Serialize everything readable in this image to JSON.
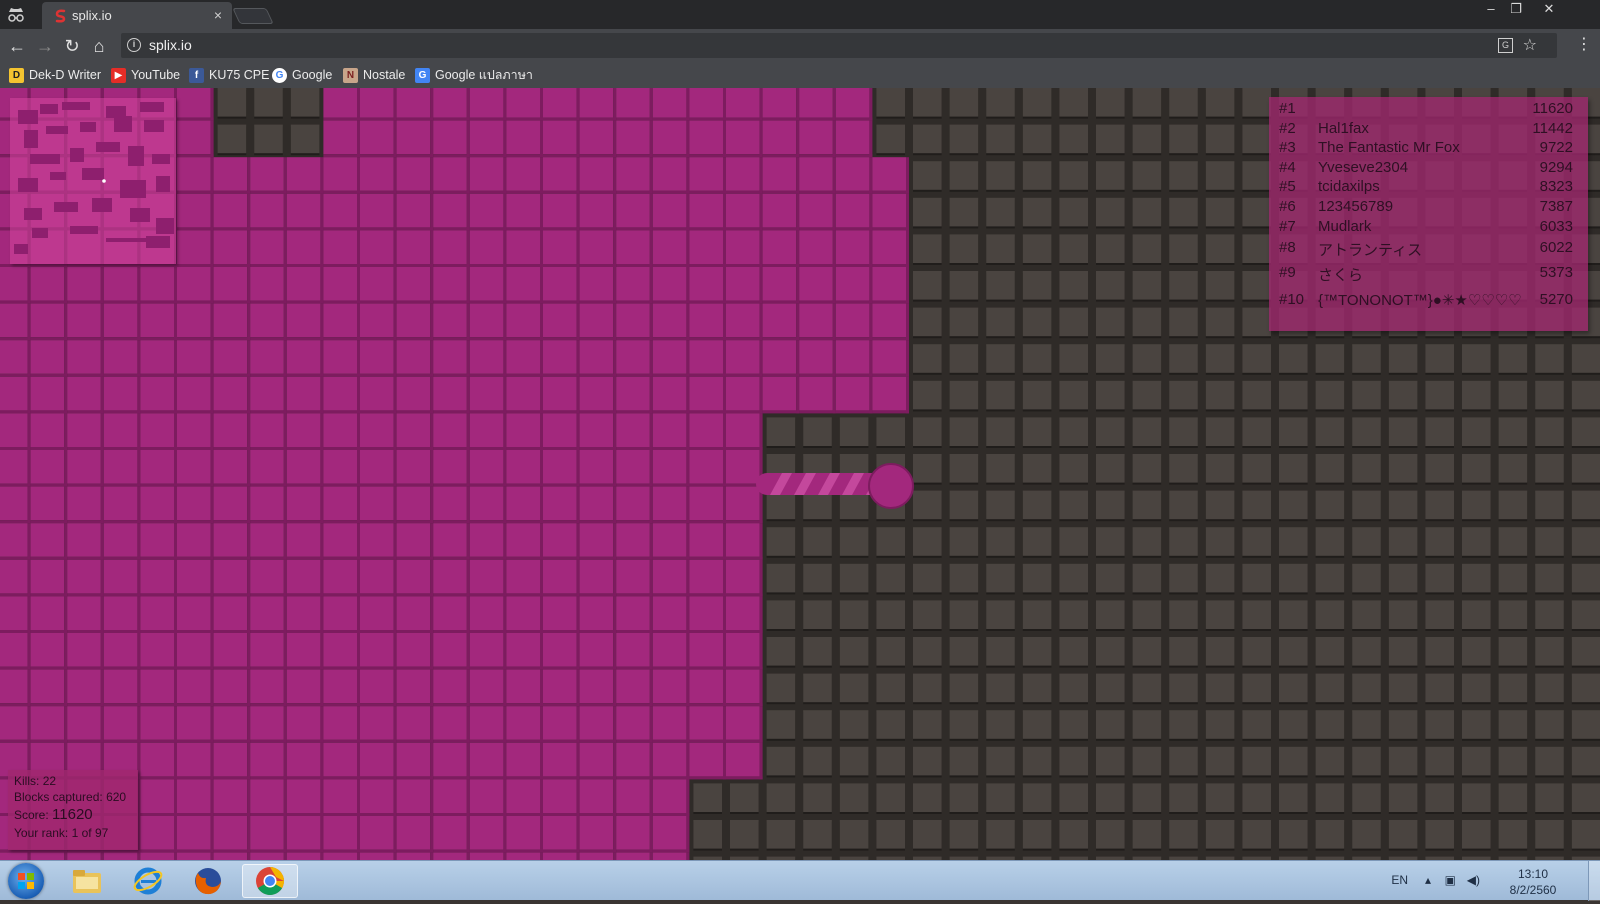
{
  "browser": {
    "tab_title": "splix.io",
    "tab_close": "×",
    "url": "splix.io",
    "window_controls": {
      "minimize": "–",
      "restore": "❐",
      "close": "✕"
    },
    "nav": {
      "back": "←",
      "forward": "→",
      "reload": "↻",
      "home": "⌂"
    },
    "bookmarks": [
      {
        "label": "Dek-D Writer",
        "icon": "dekd-icon",
        "color": "#f4c430"
      },
      {
        "label": "YouTube",
        "icon": "youtube-icon",
        "color": "#e52d27"
      },
      {
        "label": "KU75 CPE",
        "icon": "facebook-icon",
        "color": "#3b5998"
      },
      {
        "label": "Google",
        "icon": "google-icon",
        "color": "#4285f4"
      },
      {
        "label": "Nostale",
        "icon": "nostale-icon",
        "color": "#a33"
      },
      {
        "label": "Google แปลภาษา",
        "icon": "google-translate-icon",
        "color": "#4285f4"
      }
    ]
  },
  "game": {
    "player_color": "#a3287d",
    "leaderboard": [
      {
        "rank": "#1",
        "name": "",
        "score": "11620"
      },
      {
        "rank": "#2",
        "name": "Hal1fax",
        "score": "11442"
      },
      {
        "rank": "#3",
        "name": "The Fantastic Mr Fox",
        "score": "9722"
      },
      {
        "rank": "#4",
        "name": "Yveseve2304",
        "score": "9294"
      },
      {
        "rank": "#5",
        "name": "tcidaxilps",
        "score": "8323"
      },
      {
        "rank": "#6",
        "name": "123456789",
        "score": "7387"
      },
      {
        "rank": "#7",
        "name": "Mudlark",
        "score": "6033"
      },
      {
        "rank": "#8",
        "name": "アトランティス",
        "score": "6022"
      },
      {
        "rank": "#9",
        "name": "さくら",
        "score": "5373"
      },
      {
        "rank": "#10",
        "name": "{™TONONOT™}●✳★♡♡♡♡",
        "score": "5270"
      }
    ],
    "stats": {
      "kills_label": "Kills:",
      "kills": "22",
      "blocks_label": "Blocks captured:",
      "blocks": "620",
      "score_label": "Score:",
      "score": "11620",
      "rank_label": "Your rank:",
      "rank": "1 of 97"
    }
  },
  "taskbar": {
    "apps": [
      "windows-explorer-icon",
      "internet-explorer-icon",
      "firefox-icon",
      "chrome-icon"
    ],
    "lang": "EN",
    "time": "13:10",
    "date": "8/2/2560"
  }
}
